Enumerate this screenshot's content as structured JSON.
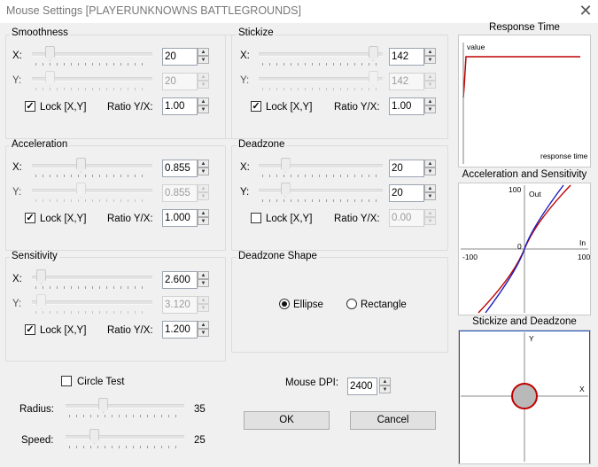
{
  "window": {
    "title": "Mouse Settings [PLAYERUNKNOWNS BATTLEGROUNDS]",
    "close_glyph": "✕"
  },
  "smoothness": {
    "title": "Smoothness",
    "x": {
      "label": "X:",
      "value": "20",
      "level": 0.12
    },
    "y": {
      "label": "Y:",
      "value": "20",
      "level": 0.12
    },
    "lock_label": "Lock [X,Y]",
    "lock_checked": true,
    "ratio_label": "Ratio Y/X:",
    "ratio_value": "1.00"
  },
  "stickize": {
    "title": "Stickize",
    "x": {
      "label": "X:",
      "value": "142",
      "level": 0.96
    },
    "y": {
      "label": "Y:",
      "value": "142",
      "level": 0.96
    },
    "lock_label": "Lock [X,Y]",
    "lock_checked": true,
    "ratio_label": "Ratio Y/X:",
    "ratio_value": "1.00"
  },
  "acceleration": {
    "title": "Acceleration",
    "x": {
      "label": "X:",
      "value": "0.855",
      "level": 0.4
    },
    "y": {
      "label": "Y:",
      "value": "0.855",
      "level": 0.4
    },
    "lock_label": "Lock [X,Y]",
    "lock_checked": true,
    "ratio_label": "Ratio Y/X:",
    "ratio_value": "1.000"
  },
  "deadzone": {
    "title": "Deadzone",
    "x": {
      "label": "X:",
      "value": "20",
      "level": 0.19
    },
    "y": {
      "label": "Y:",
      "value": "20",
      "level": 0.19
    },
    "lock_label": "Lock [X,Y]",
    "lock_checked": false,
    "ratio_label": "Ratio Y/X:",
    "ratio_value": "0.00"
  },
  "sensitivity": {
    "title": "Sensitivity",
    "x": {
      "label": "X:",
      "value": "2.600",
      "level": 0.04
    },
    "y": {
      "label": "Y:",
      "value": "3.120",
      "level": 0.04
    },
    "lock_label": "Lock [X,Y]",
    "lock_checked": true,
    "ratio_label": "Ratio Y/X:",
    "ratio_value": "1.200"
  },
  "deadzone_shape": {
    "title": "Deadzone Shape",
    "ellipse": "Ellipse",
    "rectangle": "Rectangle",
    "selected": "ellipse"
  },
  "circle_test": {
    "label": "Circle Test",
    "checked": false,
    "radius_label": "Radius:",
    "radius_value": "35",
    "radius_level": 0.3,
    "speed_label": "Speed:",
    "speed_value": "25",
    "speed_level": 0.22
  },
  "mouse_dpi": {
    "label": "Mouse DPI:",
    "value": "2400"
  },
  "buttons": {
    "ok": "OK",
    "cancel": "Cancel"
  },
  "response_time": {
    "title": "Response Time",
    "value_label": "value",
    "axis_label": "response time"
  },
  "accel_sens": {
    "title": "Acceleration and Sensitivity",
    "y_top": "100",
    "y_mid": "0",
    "x_left": "-100",
    "x_right": "100",
    "out_label": "Out",
    "in_label": "In"
  },
  "stickize_deadzone": {
    "title": "Stickize and Deadzone",
    "y_label": "Y",
    "x_label": "X"
  },
  "colors": {
    "curve_red": "#c00000",
    "curve_blue": "#1f1fbf",
    "circle_fill": "#b9b9b9",
    "accent_blue": "#1e52b8"
  }
}
